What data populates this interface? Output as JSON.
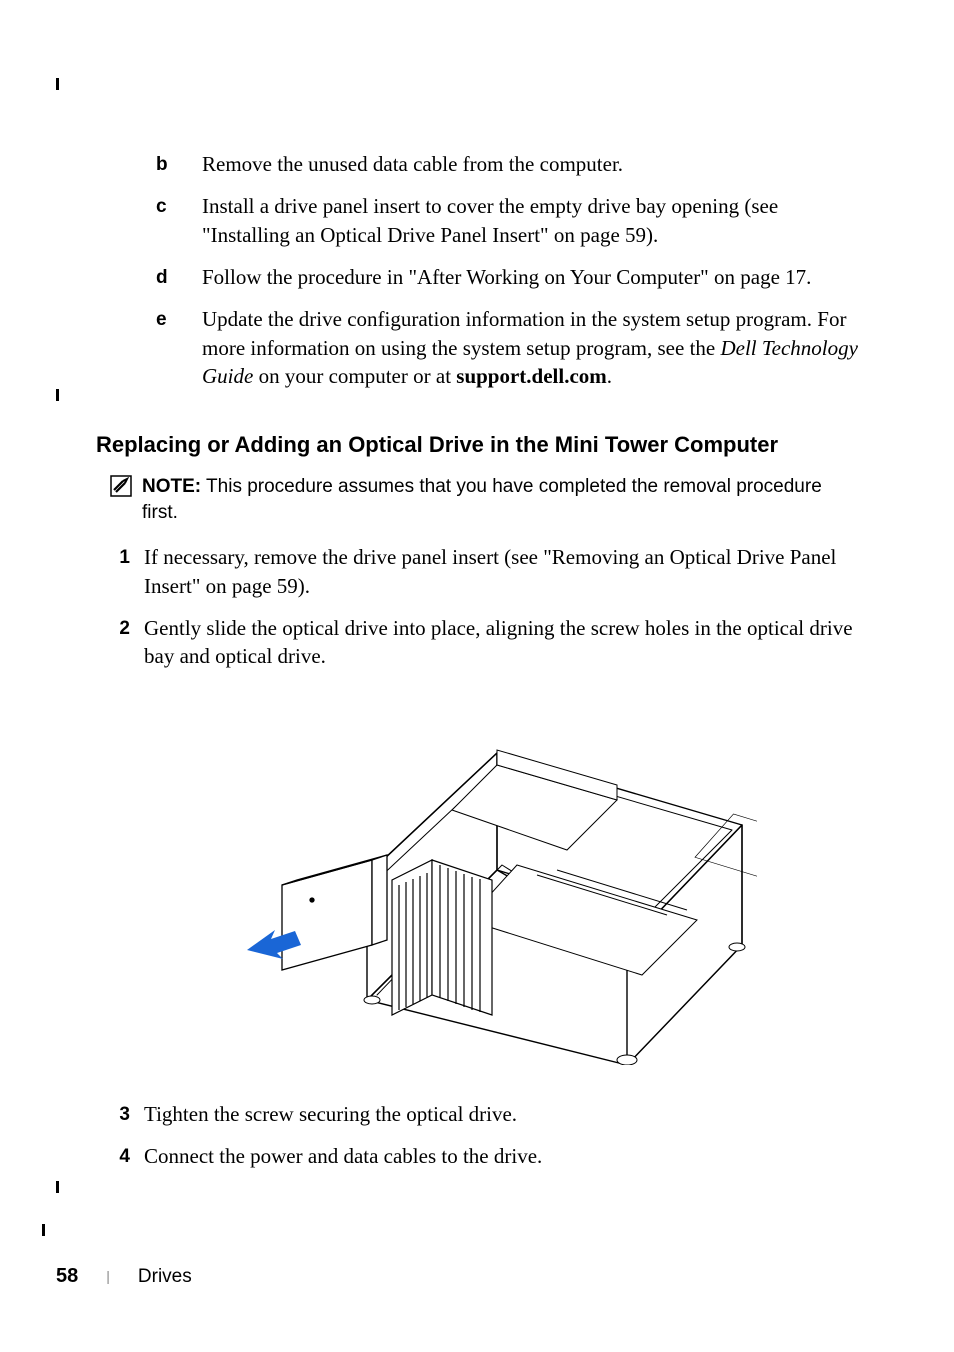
{
  "steps_letter": [
    {
      "marker": "b",
      "text": "Remove the unused data cable from the computer."
    },
    {
      "marker": "c",
      "text": "Install a drive panel insert to cover the empty drive bay opening (see \"Installing an Optical Drive Panel Insert\" on page 59)."
    },
    {
      "marker": "d",
      "text": "Follow the procedure in \"After Working on Your Computer\" on page 17."
    },
    {
      "marker": "e",
      "text_pre": "Update the drive configuration information in the system setup program. For more information on using the system setup program, see the ",
      "text_em": "Dell Technology Guide",
      "text_mid": " on your computer or at ",
      "text_bold": "support.dell.com",
      "text_post": "."
    }
  ],
  "heading": "Replacing or Adding an Optical Drive in the Mini Tower Computer",
  "note": {
    "label": "NOTE:",
    "text": " This procedure assumes that you have completed the removal procedure first."
  },
  "steps_num_top": [
    {
      "marker": "1",
      "text": "If necessary, remove the drive panel insert (see \"Removing an Optical Drive Panel Insert\" on page 59)."
    },
    {
      "marker": "2",
      "text": "Gently slide the optical drive into place, aligning the screw holes in the optical drive bay and optical drive."
    }
  ],
  "steps_num_bottom": [
    {
      "marker": "3",
      "text": "Tighten the screw securing the optical drive."
    },
    {
      "marker": "4",
      "text": "Connect the power and data cables to the drive."
    }
  ],
  "footer": {
    "page": "58",
    "separator": "|",
    "section": "Drives"
  }
}
